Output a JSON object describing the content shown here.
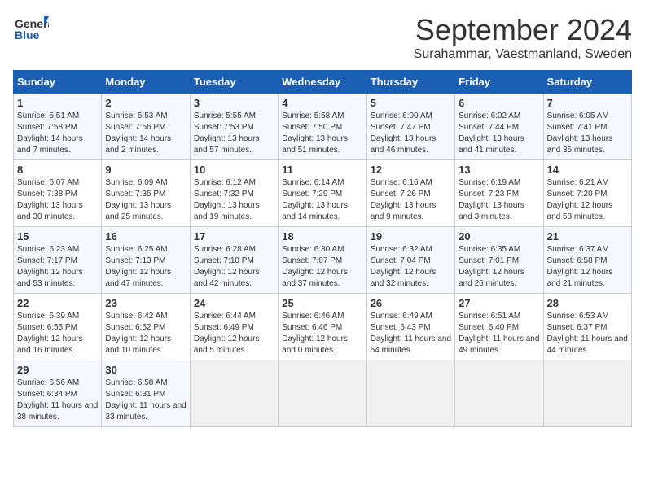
{
  "header": {
    "logo_general": "General",
    "logo_blue": "Blue",
    "month_title": "September 2024",
    "subtitle": "Surahammar, Vaestmanland, Sweden"
  },
  "days_of_week": [
    "Sunday",
    "Monday",
    "Tuesday",
    "Wednesday",
    "Thursday",
    "Friday",
    "Saturday"
  ],
  "weeks": [
    [
      {
        "day": "1",
        "sunrise": "5:51 AM",
        "sunset": "7:58 PM",
        "daylight": "14 hours and 7 minutes"
      },
      {
        "day": "2",
        "sunrise": "5:53 AM",
        "sunset": "7:56 PM",
        "daylight": "14 hours and 2 minutes"
      },
      {
        "day": "3",
        "sunrise": "5:55 AM",
        "sunset": "7:53 PM",
        "daylight": "13 hours and 57 minutes"
      },
      {
        "day": "4",
        "sunrise": "5:58 AM",
        "sunset": "7:50 PM",
        "daylight": "13 hours and 51 minutes"
      },
      {
        "day": "5",
        "sunrise": "6:00 AM",
        "sunset": "7:47 PM",
        "daylight": "13 hours and 46 minutes"
      },
      {
        "day": "6",
        "sunrise": "6:02 AM",
        "sunset": "7:44 PM",
        "daylight": "13 hours and 41 minutes"
      },
      {
        "day": "7",
        "sunrise": "6:05 AM",
        "sunset": "7:41 PM",
        "daylight": "13 hours and 35 minutes"
      }
    ],
    [
      {
        "day": "8",
        "sunrise": "6:07 AM",
        "sunset": "7:38 PM",
        "daylight": "13 hours and 30 minutes"
      },
      {
        "day": "9",
        "sunrise": "6:09 AM",
        "sunset": "7:35 PM",
        "daylight": "13 hours and 25 minutes"
      },
      {
        "day": "10",
        "sunrise": "6:12 AM",
        "sunset": "7:32 PM",
        "daylight": "13 hours and 19 minutes"
      },
      {
        "day": "11",
        "sunrise": "6:14 AM",
        "sunset": "7:29 PM",
        "daylight": "13 hours and 14 minutes"
      },
      {
        "day": "12",
        "sunrise": "6:16 AM",
        "sunset": "7:26 PM",
        "daylight": "13 hours and 9 minutes"
      },
      {
        "day": "13",
        "sunrise": "6:19 AM",
        "sunset": "7:23 PM",
        "daylight": "13 hours and 3 minutes"
      },
      {
        "day": "14",
        "sunrise": "6:21 AM",
        "sunset": "7:20 PM",
        "daylight": "12 hours and 58 minutes"
      }
    ],
    [
      {
        "day": "15",
        "sunrise": "6:23 AM",
        "sunset": "7:17 PM",
        "daylight": "12 hours and 53 minutes"
      },
      {
        "day": "16",
        "sunrise": "6:25 AM",
        "sunset": "7:13 PM",
        "daylight": "12 hours and 47 minutes"
      },
      {
        "day": "17",
        "sunrise": "6:28 AM",
        "sunset": "7:10 PM",
        "daylight": "12 hours and 42 minutes"
      },
      {
        "day": "18",
        "sunrise": "6:30 AM",
        "sunset": "7:07 PM",
        "daylight": "12 hours and 37 minutes"
      },
      {
        "day": "19",
        "sunrise": "6:32 AM",
        "sunset": "7:04 PM",
        "daylight": "12 hours and 32 minutes"
      },
      {
        "day": "20",
        "sunrise": "6:35 AM",
        "sunset": "7:01 PM",
        "daylight": "12 hours and 26 minutes"
      },
      {
        "day": "21",
        "sunrise": "6:37 AM",
        "sunset": "6:58 PM",
        "daylight": "12 hours and 21 minutes"
      }
    ],
    [
      {
        "day": "22",
        "sunrise": "6:39 AM",
        "sunset": "6:55 PM",
        "daylight": "12 hours and 16 minutes"
      },
      {
        "day": "23",
        "sunrise": "6:42 AM",
        "sunset": "6:52 PM",
        "daylight": "12 hours and 10 minutes"
      },
      {
        "day": "24",
        "sunrise": "6:44 AM",
        "sunset": "6:49 PM",
        "daylight": "12 hours and 5 minutes"
      },
      {
        "day": "25",
        "sunrise": "6:46 AM",
        "sunset": "6:46 PM",
        "daylight": "12 hours and 0 minutes"
      },
      {
        "day": "26",
        "sunrise": "6:49 AM",
        "sunset": "6:43 PM",
        "daylight": "11 hours and 54 minutes"
      },
      {
        "day": "27",
        "sunrise": "6:51 AM",
        "sunset": "6:40 PM",
        "daylight": "11 hours and 49 minutes"
      },
      {
        "day": "28",
        "sunrise": "6:53 AM",
        "sunset": "6:37 PM",
        "daylight": "11 hours and 44 minutes"
      }
    ],
    [
      {
        "day": "29",
        "sunrise": "6:56 AM",
        "sunset": "6:34 PM",
        "daylight": "11 hours and 38 minutes"
      },
      {
        "day": "30",
        "sunrise": "6:58 AM",
        "sunset": "6:31 PM",
        "daylight": "11 hours and 33 minutes"
      },
      null,
      null,
      null,
      null,
      null
    ]
  ]
}
